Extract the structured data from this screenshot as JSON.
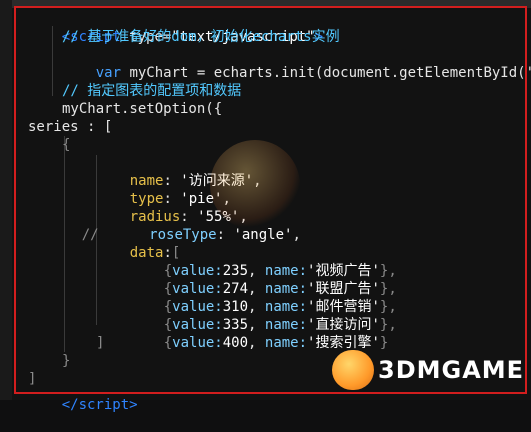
{
  "code": {
    "l1": {
      "open": "<script",
      "attr": " type=",
      "val": "\"text/javascript\"",
      "close": ">"
    },
    "l2": {
      "text": "// 基于准备好的dom，初始化echarts实例"
    },
    "l3": {
      "kw": "var",
      "rest": " myChart = echarts.init(document.getElementById('ma"
    },
    "l4": {
      "text": "// 指定图表的配置项和数据"
    },
    "l5": {
      "text": "myChart.setOption({"
    },
    "l6": {
      "text": "series : ["
    },
    "l7": {
      "text": "{"
    },
    "l8": {
      "key": "name",
      "sep": ": ",
      "val": "'访问来源'",
      "end": ","
    },
    "l9": {
      "key": "type",
      "sep": ": ",
      "val": "'pie'",
      "end": ","
    },
    "l10": {
      "key": "radius",
      "sep": ": ",
      "val": "'55%'",
      "end": ","
    },
    "l11": {
      "prefix": "//",
      "key": "roseType",
      "sep": ": ",
      "val": "'angle'",
      "end": ","
    },
    "l12": {
      "key": "data",
      "sep": ":",
      "val": "[",
      "end": ""
    },
    "data_rows": [
      {
        "value": "235",
        "name": "'视频广告'"
      },
      {
        "value": "274",
        "name": "'联盟广告'"
      },
      {
        "value": "310",
        "name": "'邮件营销'"
      },
      {
        "value": "335",
        "name": "'直接访问'"
      },
      {
        "value": "400",
        "name": "'搜索引擎'"
      }
    ],
    "l18": {
      "text": "]"
    },
    "l19": {
      "text": "}"
    },
    "l20": {
      "text": "]"
    },
    "l21": {
      "text": "})"
    },
    "l22": {
      "open": "</script",
      "close": ">"
    }
  },
  "watermark": {
    "brand": "3DMGAME"
  },
  "colors": {
    "highlight_frame": "#d21e1e",
    "background": "#121212",
    "keyword": "#47a1ff",
    "comment": "#52c9ff",
    "string": "#ffffff"
  }
}
